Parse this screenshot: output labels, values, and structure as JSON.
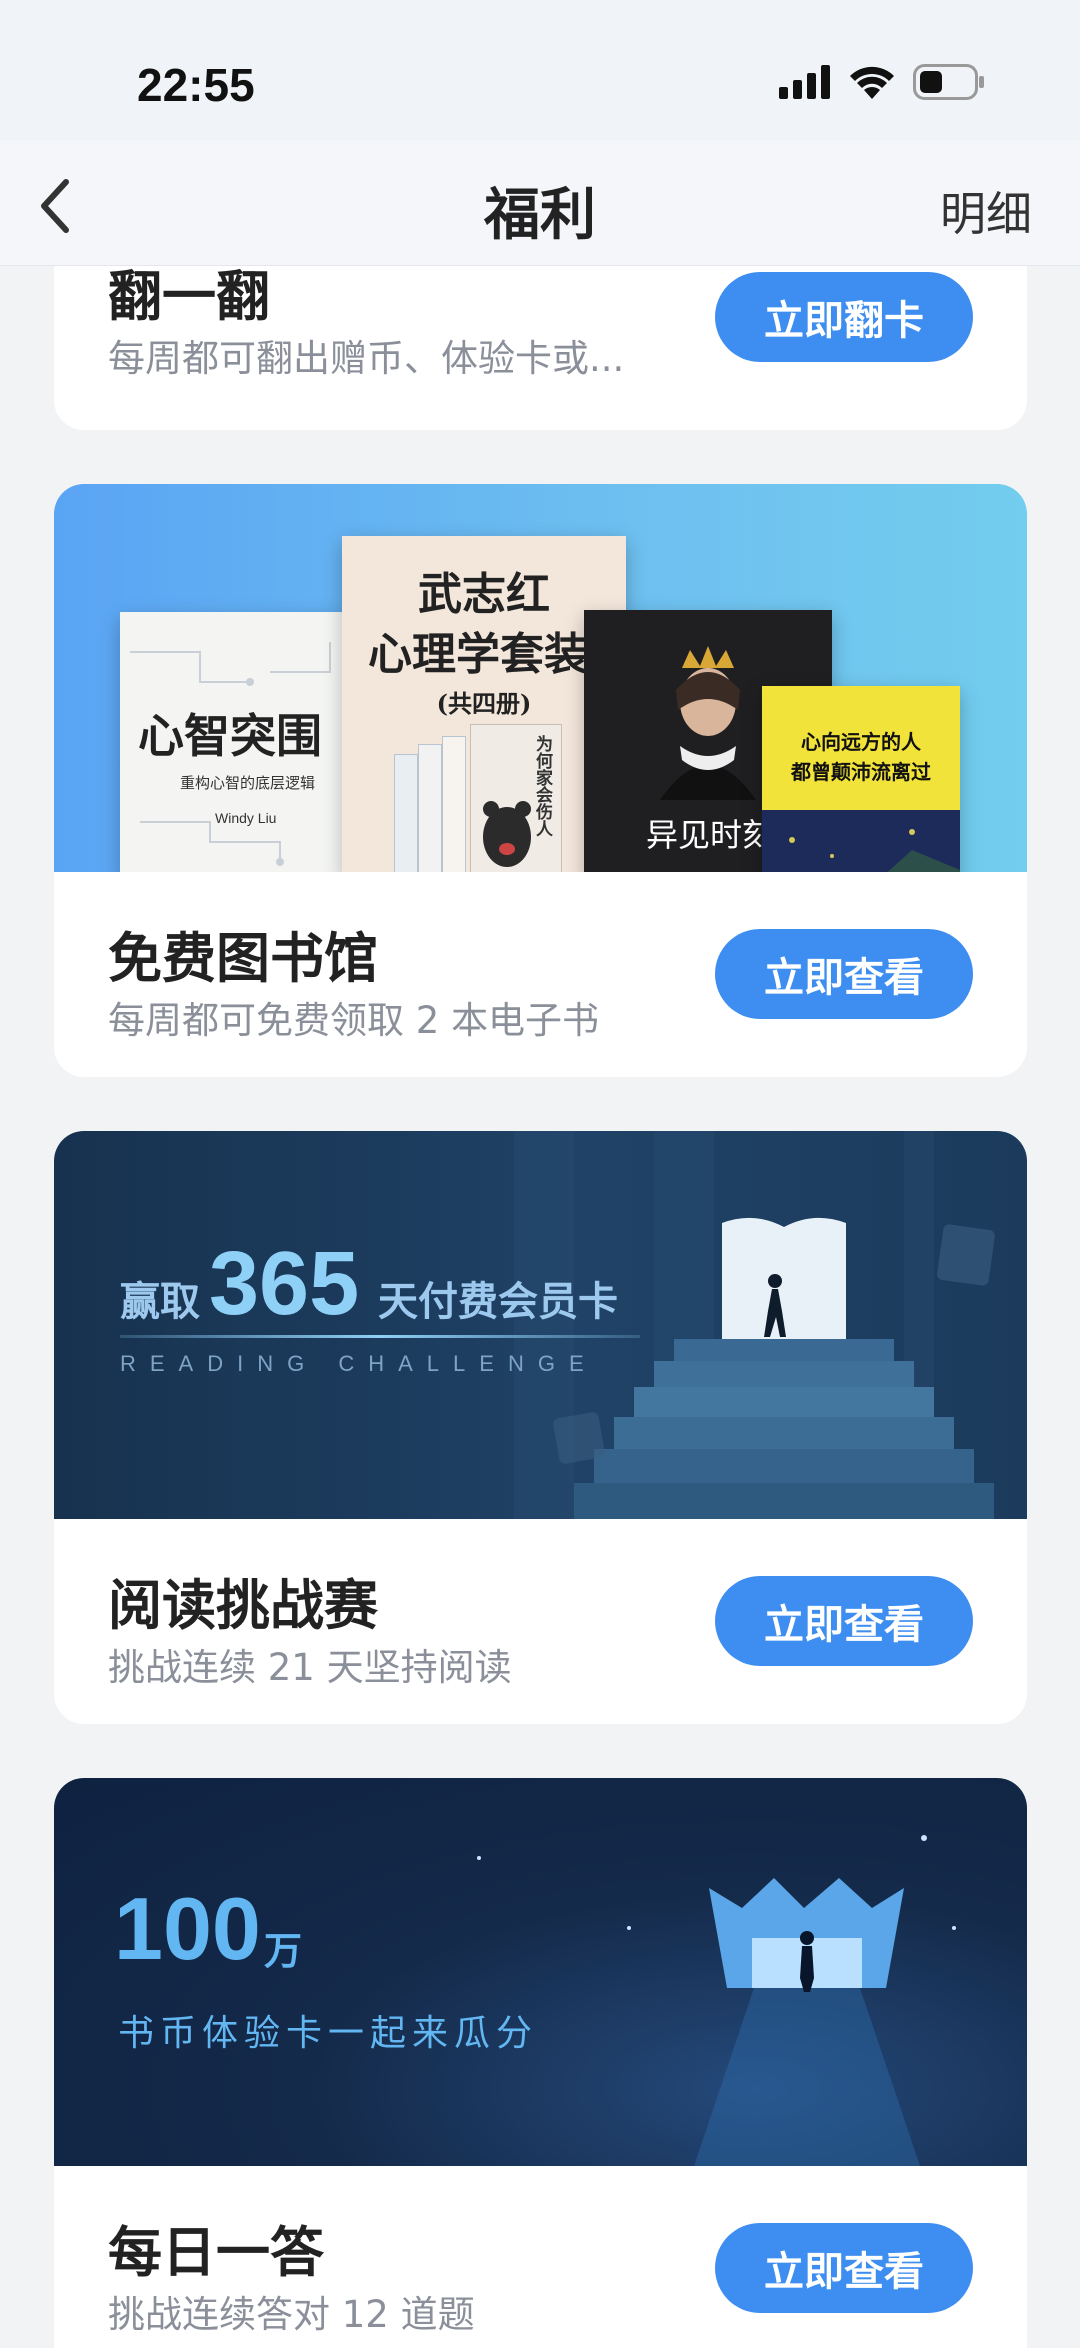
{
  "status": {
    "time": "22:55"
  },
  "nav": {
    "title": "福利",
    "detail": "明细"
  },
  "cards": [
    {
      "title": "翻一翻",
      "desc": "每周都可翻出赠币、体验卡或...",
      "button": "立即翻卡"
    },
    {
      "title": "免费图书馆",
      "desc": "每周都可免费领取 2 本电子书",
      "button": "立即查看",
      "banner": {
        "books": [
          {
            "title": "心智突围",
            "sub": "重构心智的底层逻辑",
            "author": "Windy Liu"
          },
          {
            "title": "武志红",
            "title2": "心理学套装",
            "sub": "(共四册)",
            "spine": "为何家会伤人"
          },
          {
            "title": "异见时刻"
          },
          {
            "title": "心向远方的人",
            "title2": "都曾颠沛流离过"
          }
        ]
      }
    },
    {
      "title": "阅读挑战赛",
      "desc": "挑战连续 21 天坚持阅读",
      "button": "立即查看",
      "banner": {
        "prefix": "赢取",
        "number": "365",
        "suffix": "天付费会员卡",
        "subtitle": "READING CHALLENGE"
      }
    },
    {
      "title": "每日一答",
      "desc": "挑战连续答对 12 道题",
      "button": "立即查看",
      "banner": {
        "number": "100",
        "unit": "万",
        "subtitle": "书币体验卡一起来瓜分"
      }
    }
  ],
  "colors": {
    "accent": "#3d8ef0",
    "background": "#f2f3f5"
  }
}
